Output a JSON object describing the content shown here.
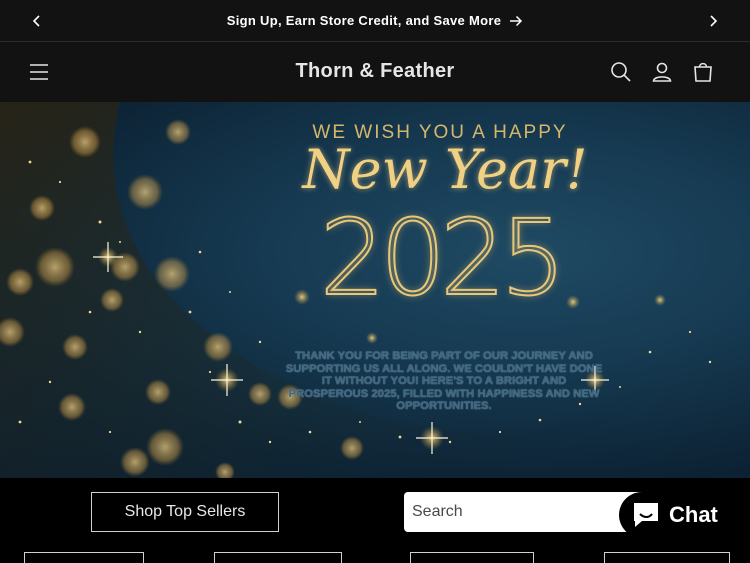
{
  "announcement": {
    "message": "Sign Up, Earn Store Credit, and Save More"
  },
  "header": {
    "store_name": "Thorn & Feather"
  },
  "hero": {
    "line1": "WE WISH YOU A HAPPY",
    "line2": "New Year!",
    "year": "2025",
    "message": "THANK YOU FOR BEING PART OF OUR JOURNEY AND SUPPORTING US ALL ALONG. WE COULDN'T HAVE DONE IT WITHOUT YOU! HERE'S TO A BRIGHT AND PROSPEROUS 2025, FILLED WITH HAPPINESS AND NEW OPPORTUNITIES."
  },
  "actions": {
    "shop_top_sellers": "Shop Top Sellers",
    "search_placeholder": "Search",
    "chat_label": "Chat"
  },
  "colors": {
    "bar_bg": "#121212",
    "gold": "#e8c77a",
    "hero_blue": "#163a52"
  }
}
